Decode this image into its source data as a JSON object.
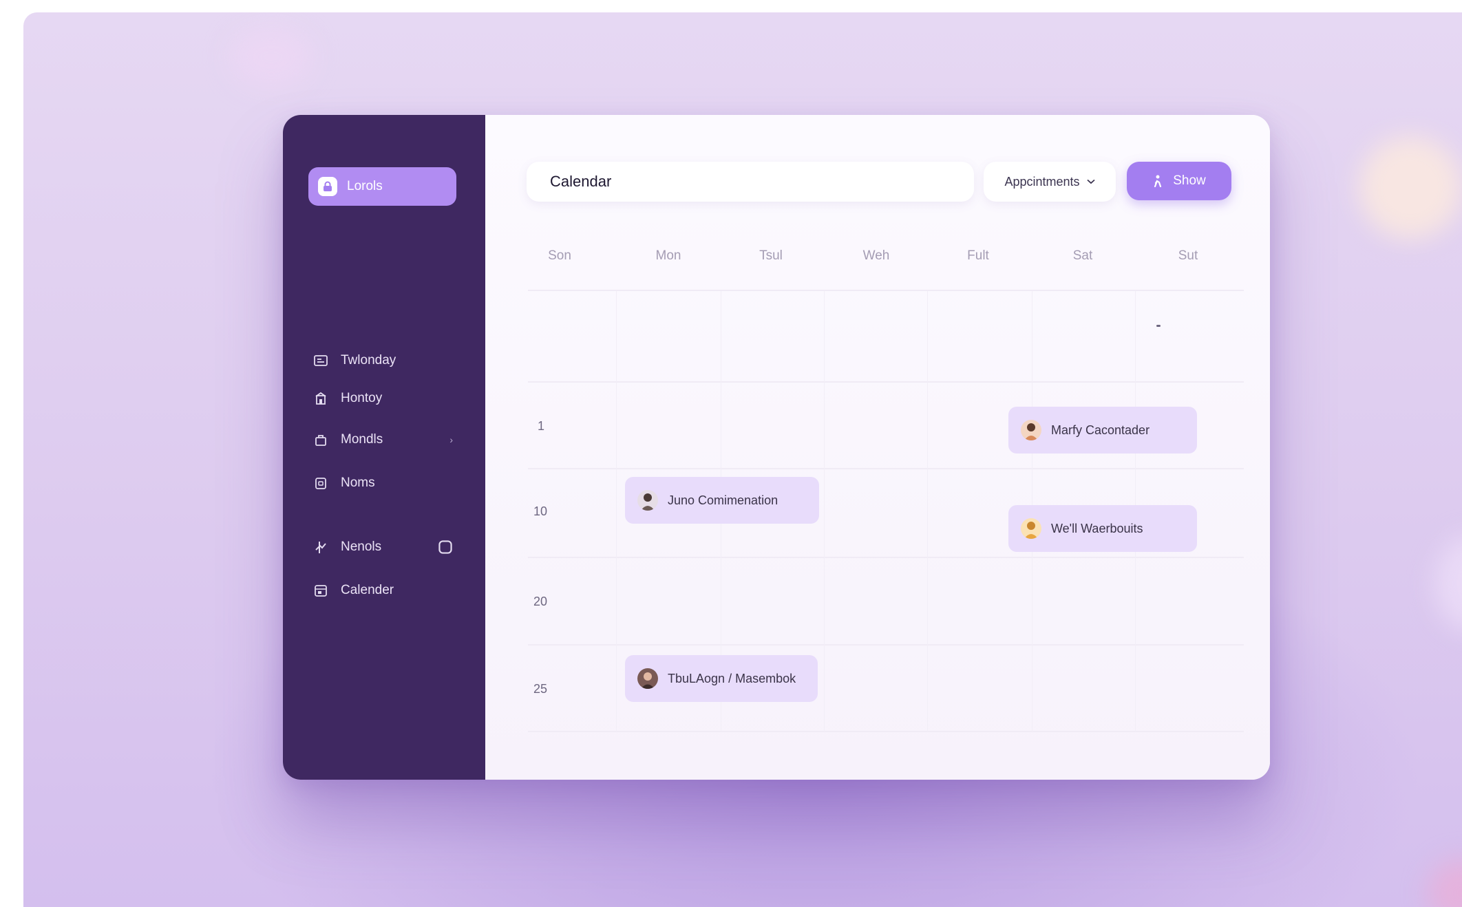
{
  "colors": {
    "sidebar_bg": "#3f2861",
    "accent": "#a37ef0",
    "event_bg": "#e8dcfb",
    "backdrop": "#e2d3f2"
  },
  "sidebar": {
    "brand": {
      "label": "Lorols",
      "icon": "lock-icon"
    },
    "items": [
      {
        "label": "Twlonday",
        "icon": "newspaper-icon"
      },
      {
        "label": "Hontoy",
        "icon": "building-icon"
      },
      {
        "label": "Mondls",
        "icon": "bag-icon",
        "trailing": "›"
      },
      {
        "label": "Noms",
        "icon": "clipboard-icon"
      },
      {
        "label": "Nenols",
        "icon": "swap-icon",
        "trailing_icon": "square-icon"
      },
      {
        "label": "Calender",
        "icon": "calendar-icon"
      }
    ]
  },
  "header": {
    "search_value": "Calendar",
    "dropdown_label": "Appcintments",
    "show_label": "Show"
  },
  "calendar": {
    "days": [
      "Son",
      "Mon",
      "Tsul",
      "Weh",
      "Fult",
      "Sat",
      "Sut"
    ],
    "row_labels": [
      "1",
      "10",
      "20",
      "25"
    ],
    "events": [
      {
        "name": "Marfy Cacontader",
        "avatar": "person-icon"
      },
      {
        "name": "Juno Comimenation",
        "avatar": "person-icon"
      },
      {
        "name": "We'll Waerbouits",
        "avatar": "person-icon"
      },
      {
        "name": "TbuLAogn / Masembok",
        "avatar": "person-icon"
      }
    ]
  }
}
